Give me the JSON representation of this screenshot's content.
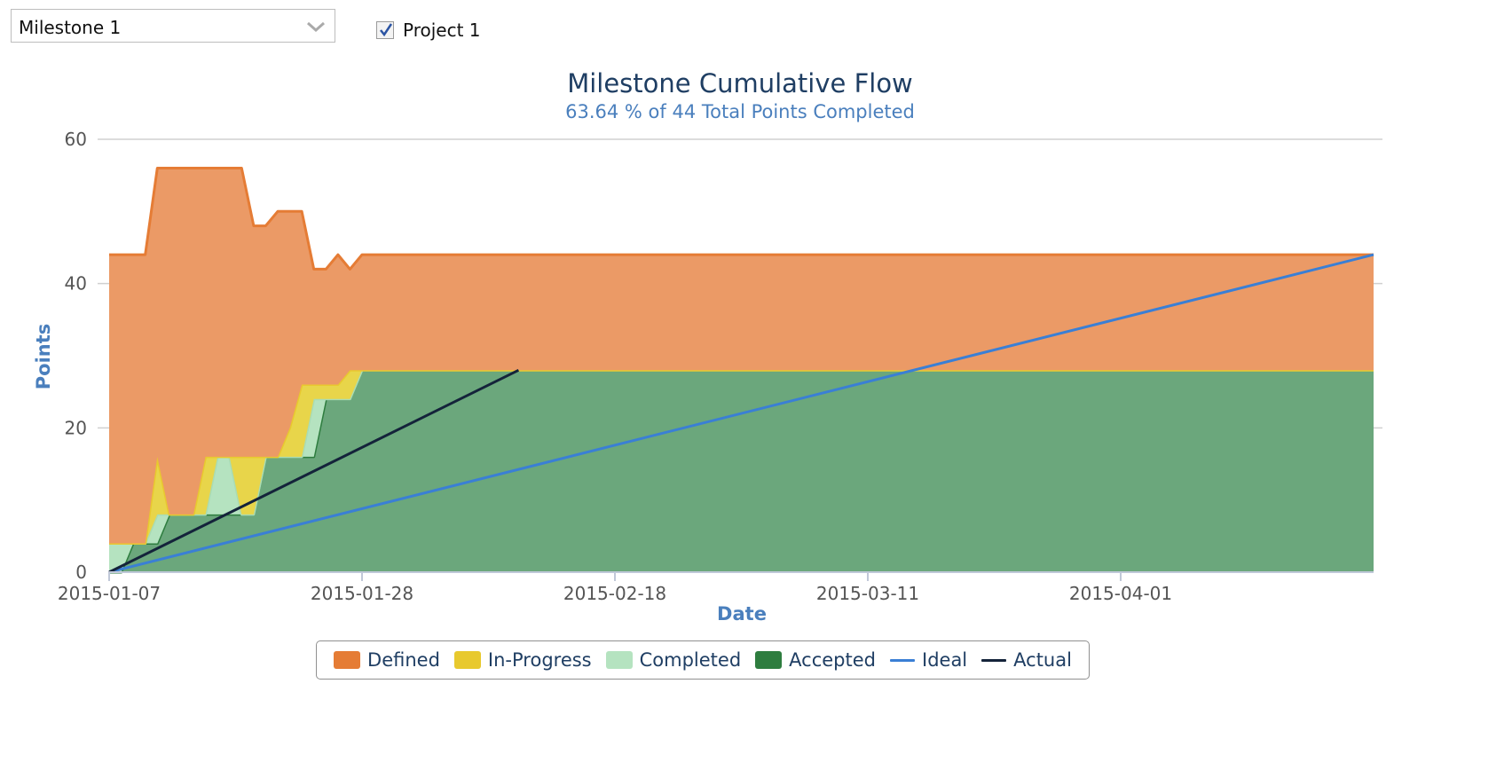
{
  "controls": {
    "milestone_select": {
      "value": "Milestone 1"
    },
    "project_checkbox": {
      "label": "Project 1",
      "checked": true
    }
  },
  "chart_data": {
    "type": "area",
    "title": "Milestone Cumulative Flow",
    "subtitle": "63.64 % of 44 Total Points Completed",
    "xlabel": "Date",
    "ylabel": "Points",
    "x_ticks": [
      "2015-01-07",
      "2015-01-28",
      "2015-02-18",
      "2015-03-11",
      "2015-04-01"
    ],
    "y_ticks": [
      0,
      20,
      40,
      60
    ],
    "ylim": [
      0,
      60
    ],
    "xlim": [
      "2015-01-07",
      "2015-04-22"
    ],
    "grid": true,
    "legend_position": "bottom",
    "stacked": true,
    "x": [
      "2015-01-07",
      "2015-01-08",
      "2015-01-09",
      "2015-01-10",
      "2015-01-11",
      "2015-01-12",
      "2015-01-13",
      "2015-01-14",
      "2015-01-15",
      "2015-01-16",
      "2015-01-17",
      "2015-01-18",
      "2015-01-19",
      "2015-01-20",
      "2015-01-21",
      "2015-01-22",
      "2015-01-23",
      "2015-01-24",
      "2015-01-25",
      "2015-01-26",
      "2015-01-27",
      "2015-01-28",
      "2015-01-29",
      "2015-01-30",
      "2015-01-31",
      "2015-02-01",
      "2015-02-02",
      "2015-02-03",
      "2015-02-04",
      "2015-04-22"
    ],
    "series": [
      {
        "name": "Accepted",
        "color": "#2e7d3f",
        "fill": "#6ba77c",
        "values": [
          0,
          0,
          4,
          4,
          4,
          8,
          8,
          8,
          8,
          8,
          8,
          8,
          8,
          16,
          16,
          16,
          16,
          16,
          24,
          24,
          24,
          28,
          28,
          28,
          28,
          28,
          28,
          28,
          28,
          28
        ]
      },
      {
        "name": "Completed",
        "color": "#a9dcb4",
        "fill": "#b5e3c0",
        "values": [
          4,
          4,
          0,
          0,
          4,
          0,
          0,
          0,
          0,
          8,
          8,
          0,
          0,
          0,
          0,
          0,
          0,
          8,
          0,
          0,
          0,
          0,
          0,
          0,
          0,
          0,
          0,
          0,
          0,
          0
        ]
      },
      {
        "name": "In-Progress",
        "color": "#e8c92e",
        "fill": "#e8d54a",
        "values": [
          0,
          0,
          0,
          0,
          8,
          0,
          0,
          0,
          8,
          0,
          0,
          8,
          8,
          0,
          0,
          4,
          10,
          2,
          2,
          2,
          4,
          0,
          0,
          0,
          0,
          0,
          0,
          0,
          0,
          0
        ]
      },
      {
        "name": "Defined",
        "color": "#e57c35",
        "fill": "#eb9a66",
        "values": [
          40,
          40,
          40,
          40,
          40,
          48,
          48,
          48,
          40,
          40,
          40,
          40,
          32,
          32,
          34,
          30,
          24,
          16,
          16,
          18,
          14,
          16,
          16,
          16,
          16,
          16,
          16,
          16,
          16,
          16
        ]
      }
    ],
    "lines": [
      {
        "name": "Ideal",
        "color": "#3a7fd5",
        "x": [
          "2015-01-07",
          "2015-04-22"
        ],
        "values": [
          0,
          44
        ]
      },
      {
        "name": "Actual",
        "color": "#14233a",
        "x": [
          "2015-01-07",
          "2015-02-10"
        ],
        "values": [
          0,
          28
        ]
      }
    ],
    "legend": [
      {
        "name": "Defined",
        "kind": "area",
        "color": "#e57c35"
      },
      {
        "name": "In-Progress",
        "kind": "area",
        "color": "#e8c92e"
      },
      {
        "name": "Completed",
        "kind": "area",
        "color": "#b5e3c0"
      },
      {
        "name": "Accepted",
        "kind": "area",
        "color": "#2e7d3f"
      },
      {
        "name": "Ideal",
        "kind": "line",
        "color": "#3a7fd5"
      },
      {
        "name": "Actual",
        "kind": "line",
        "color": "#14233a"
      }
    ]
  }
}
